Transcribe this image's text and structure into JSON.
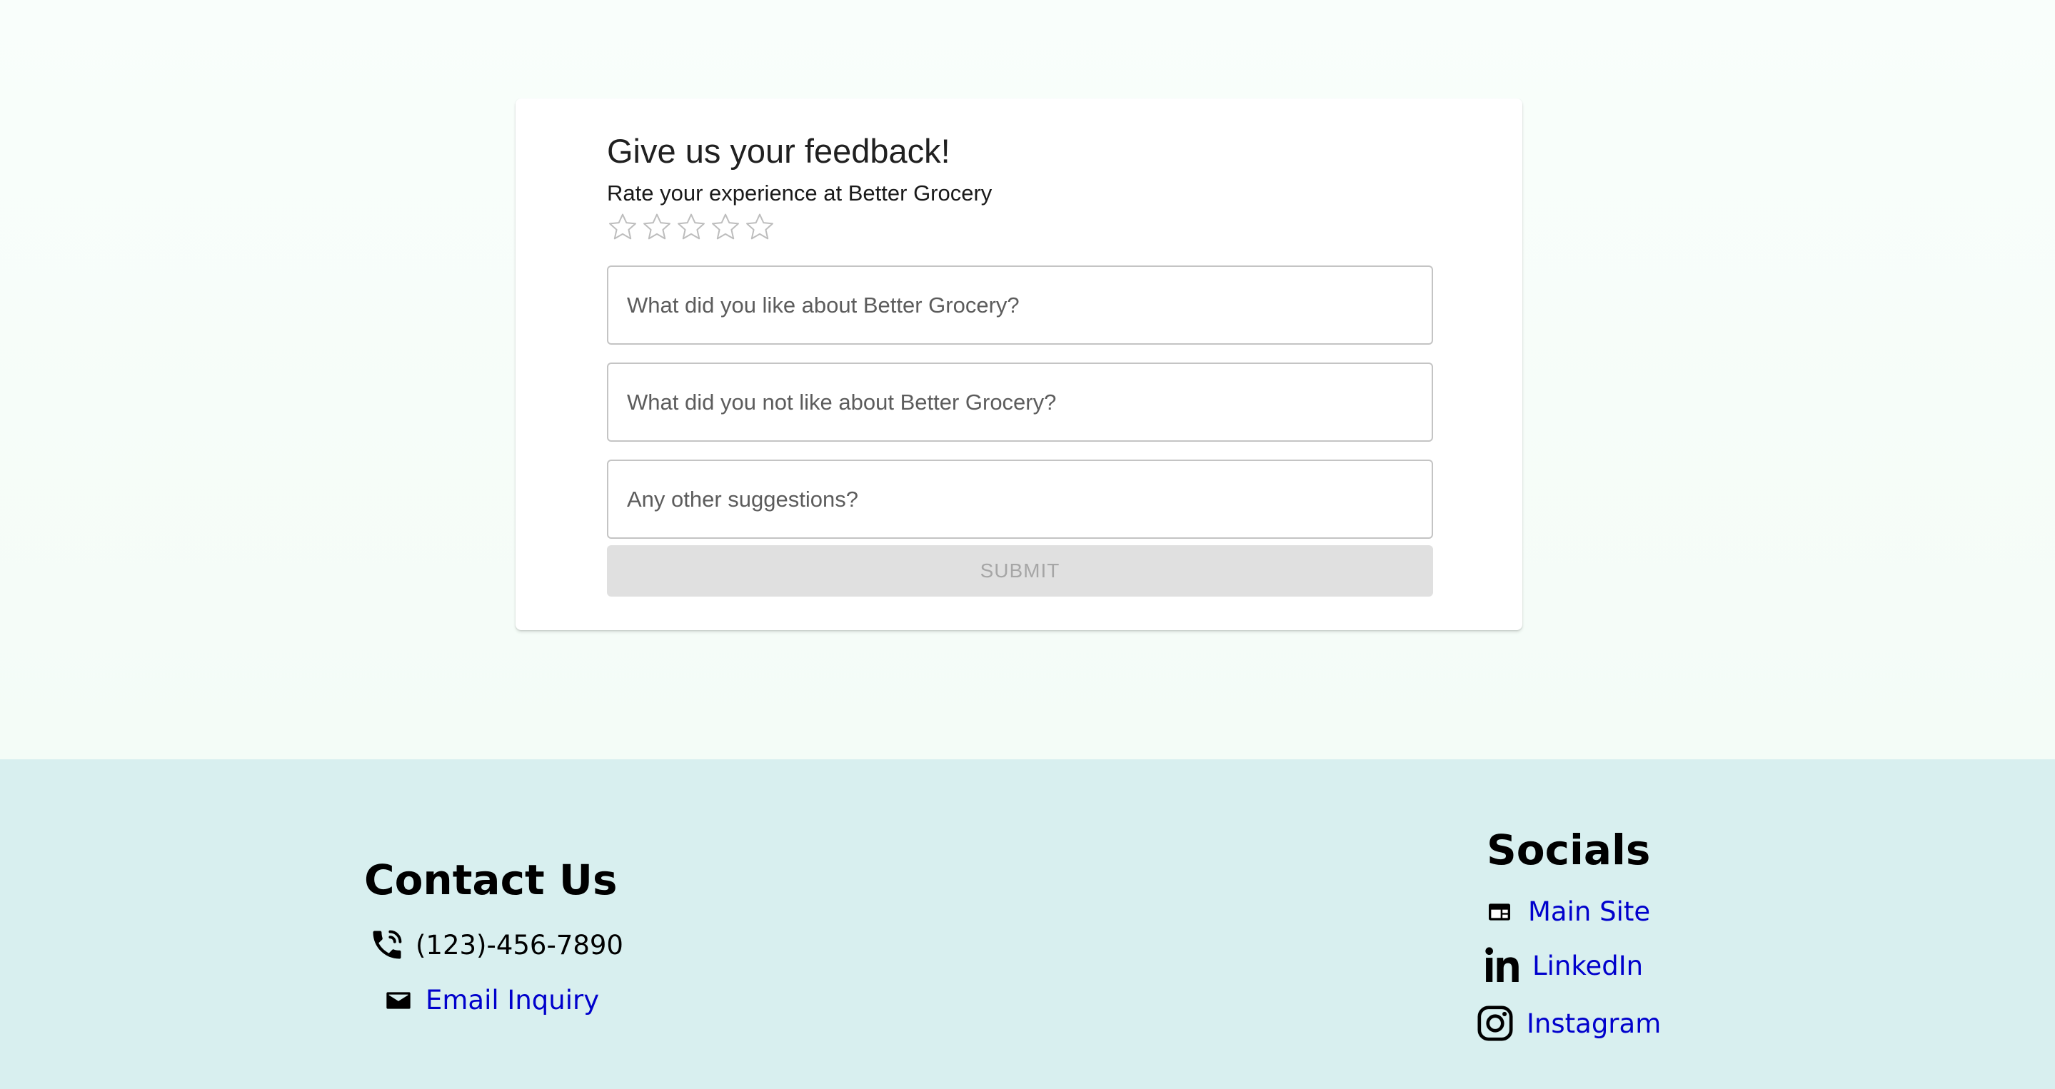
{
  "form": {
    "title": "Give us your feedback!",
    "subtitle": "Rate your experience at Better Grocery",
    "rating": {
      "value": 0,
      "max": 5,
      "star_color": "#bdbdbd"
    },
    "fields": [
      {
        "placeholder": "What did you like about Better Grocery?",
        "value": ""
      },
      {
        "placeholder": "What did you not like about Better Grocery?",
        "value": ""
      },
      {
        "placeholder": "Any other suggestions?",
        "value": ""
      }
    ],
    "submit_label": "Submit"
  },
  "footer": {
    "background": "#d8efef",
    "contact": {
      "title": "Contact Us",
      "phone": {
        "icon": "phone-icon",
        "text": "(123)-456-7890"
      },
      "email": {
        "icon": "mail-icon",
        "text": "Email Inquiry"
      }
    },
    "socials": {
      "title": "Socials",
      "links": [
        {
          "icon": "website-icon",
          "label": "Main Site"
        },
        {
          "icon": "linkedin-icon",
          "label": "LinkedIn"
        },
        {
          "icon": "instagram-icon",
          "label": "Instagram"
        }
      ]
    },
    "link_color": "#0000cc"
  }
}
